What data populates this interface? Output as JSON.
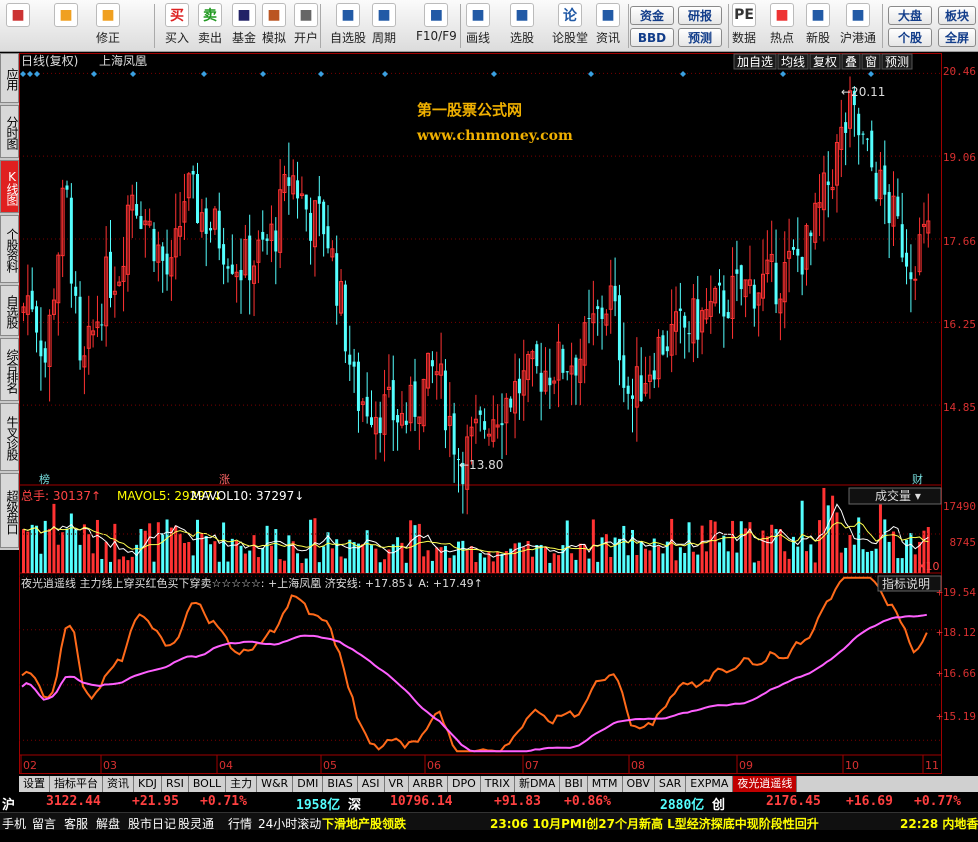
{
  "toolbar": {
    "buttons": [
      {
        "label": "",
        "icon": "grid-icon"
      },
      {
        "label": "",
        "icon": "back-arrow-icon"
      },
      {
        "label": "修正",
        "icon": "refresh-icon"
      },
      {
        "label": "买入",
        "icon": "buy-icon",
        "glyph": "买"
      },
      {
        "label": "卖出",
        "icon": "sell-icon",
        "glyph": "卖"
      },
      {
        "label": "基金",
        "icon": "fund-icon"
      },
      {
        "label": "模拟",
        "icon": "hammer-icon"
      },
      {
        "label": "开户",
        "icon": "lock-icon"
      },
      {
        "label": "自选股",
        "icon": "star-list-icon"
      },
      {
        "label": "周期",
        "icon": "clock-icon"
      },
      {
        "label": "F10/F9",
        "icon": "f10-icon"
      },
      {
        "label": "画线",
        "icon": "pencil-icon"
      },
      {
        "label": "选股",
        "icon": "screen-icon"
      },
      {
        "label": "论股堂",
        "icon": "forum-icon",
        "glyph": "论"
      },
      {
        "label": "资讯",
        "icon": "news-icon"
      },
      {
        "label": "数据",
        "icon": "pe-icon",
        "glyph": "PE"
      },
      {
        "label": "热点",
        "icon": "hot-icon"
      },
      {
        "label": "新股",
        "icon": "ipo-icon"
      },
      {
        "label": "沪港通",
        "icon": "sse-hk-icon"
      }
    ],
    "boxes": {
      "zijin": "资金",
      "bbd": "BBD",
      "yanbao": "研报",
      "yuce": "预测",
      "dapan": "大盘",
      "bankuai": "板块",
      "gegu": "个股",
      "quanping": "全屏"
    }
  },
  "sidetabs": [
    "应用",
    "分时图",
    "K线图",
    "个股资料",
    "自选股",
    "综合排名",
    "牛叉诊股",
    "超级盘口"
  ],
  "chart": {
    "title": "日线(复权)",
    "stock": "上海凤凰",
    "top_buttons": [
      "加自选",
      "均线",
      "复权",
      "叠",
      "窗",
      "预测"
    ],
    "watermark1": "第一股票公式网",
    "watermark2": "www.chnmoney.com",
    "high_label": "20.11",
    "low_label": "13.80",
    "marker1": "榜",
    "marker2": "涨",
    "marker3": "财",
    "vol_title": "总手: 30137↑",
    "mavol5": "MAVOL5: 29297↓",
    "mavol10": "MAVOL10: 37297↓",
    "vol_dropdown": "成交量",
    "vol_scale": "X10",
    "ind_title": "夜光逍遥线 主力线上穿买红色买下穿卖☆☆☆☆☆: +上海凤凰 济安线: +17.85↓ A: +17.49↑",
    "ind_button": "指标说明",
    "dates": [
      "02",
      "03",
      "04",
      "05",
      "06",
      "07",
      "08",
      "09",
      "10",
      "11"
    ]
  },
  "axis": {
    "price": [
      "20.46",
      "19.06",
      "17.66",
      "16.25",
      "14.85"
    ],
    "vol": [
      "17490",
      "8745"
    ],
    "ind": [
      "+19.54",
      "+18.12",
      "+16.66",
      "+15.19"
    ]
  },
  "bottom_tabs": [
    "设置",
    "指标平台",
    "资讯",
    "KDJ",
    "RSI",
    "BOLL",
    "主力",
    "W&R",
    "DMI",
    "BIAS",
    "ASI",
    "VR",
    "ARBR",
    "DPO",
    "TRIX",
    "新DMA",
    "BBI",
    "MTM",
    "OBV",
    "SAR",
    "EXPMA",
    "夜光逍遥线"
  ],
  "quotes": {
    "sh": "沪",
    "sh_val": "3122.44",
    "sh_chg": "+21.95",
    "sh_pct": "+0.71%",
    "sh_amt": "1958亿",
    "sz": "深",
    "sz_val": "10796.14",
    "sz_chg": "+91.83",
    "sz_pct": "+0.86%",
    "sz_amt": "2880亿",
    "cy": "创",
    "cy_val": "2176.45",
    "cy_chg": "+16.69",
    "cy_pct": "+0.77%"
  },
  "status": {
    "items": [
      "手机",
      "留言",
      "客服",
      "解盘",
      "股市日记",
      "股灵通",
      "行情",
      "24小时滚动"
    ],
    "news1": "下滑地产股领跌",
    "news2": "23:06 10月PMI创27个月新高 L型经济探底中现阶段性回升",
    "news3": "22:28 内地香"
  },
  "chart_data": {
    "type": "candlestick",
    "ylim": [
      13.5,
      20.5
    ],
    "high": 20.11,
    "low": 13.8,
    "vol_ylim": [
      0,
      17490
    ],
    "ind_ylim": [
      14.8,
      19.6
    ]
  },
  "colors": {
    "up": "#ff3232",
    "down": "#54ffff",
    "axis": "#d83030",
    "grid": "#7a0000"
  }
}
